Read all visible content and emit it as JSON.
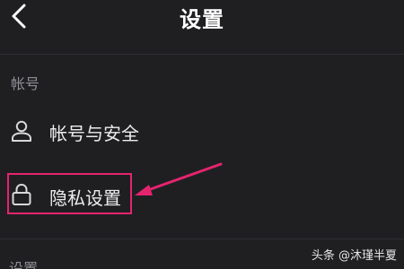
{
  "header": {
    "title": "设置",
    "back_icon": "chevron-left-icon"
  },
  "sections": [
    {
      "label": "帐号",
      "items": [
        {
          "label": "帐号与安全",
          "icon": "user-icon"
        },
        {
          "label": "隐私设置",
          "icon": "lock-icon",
          "highlighted": true
        }
      ]
    },
    {
      "label": "设置"
    }
  ],
  "annotation": {
    "color": "#e5246e",
    "target": "隐私设置"
  },
  "watermark": "头条 @沐瑾半夏",
  "colors": {
    "background": "#1f1f22",
    "text": "#ececec",
    "muted": "#8f8f94",
    "highlight": "#e5246e"
  }
}
